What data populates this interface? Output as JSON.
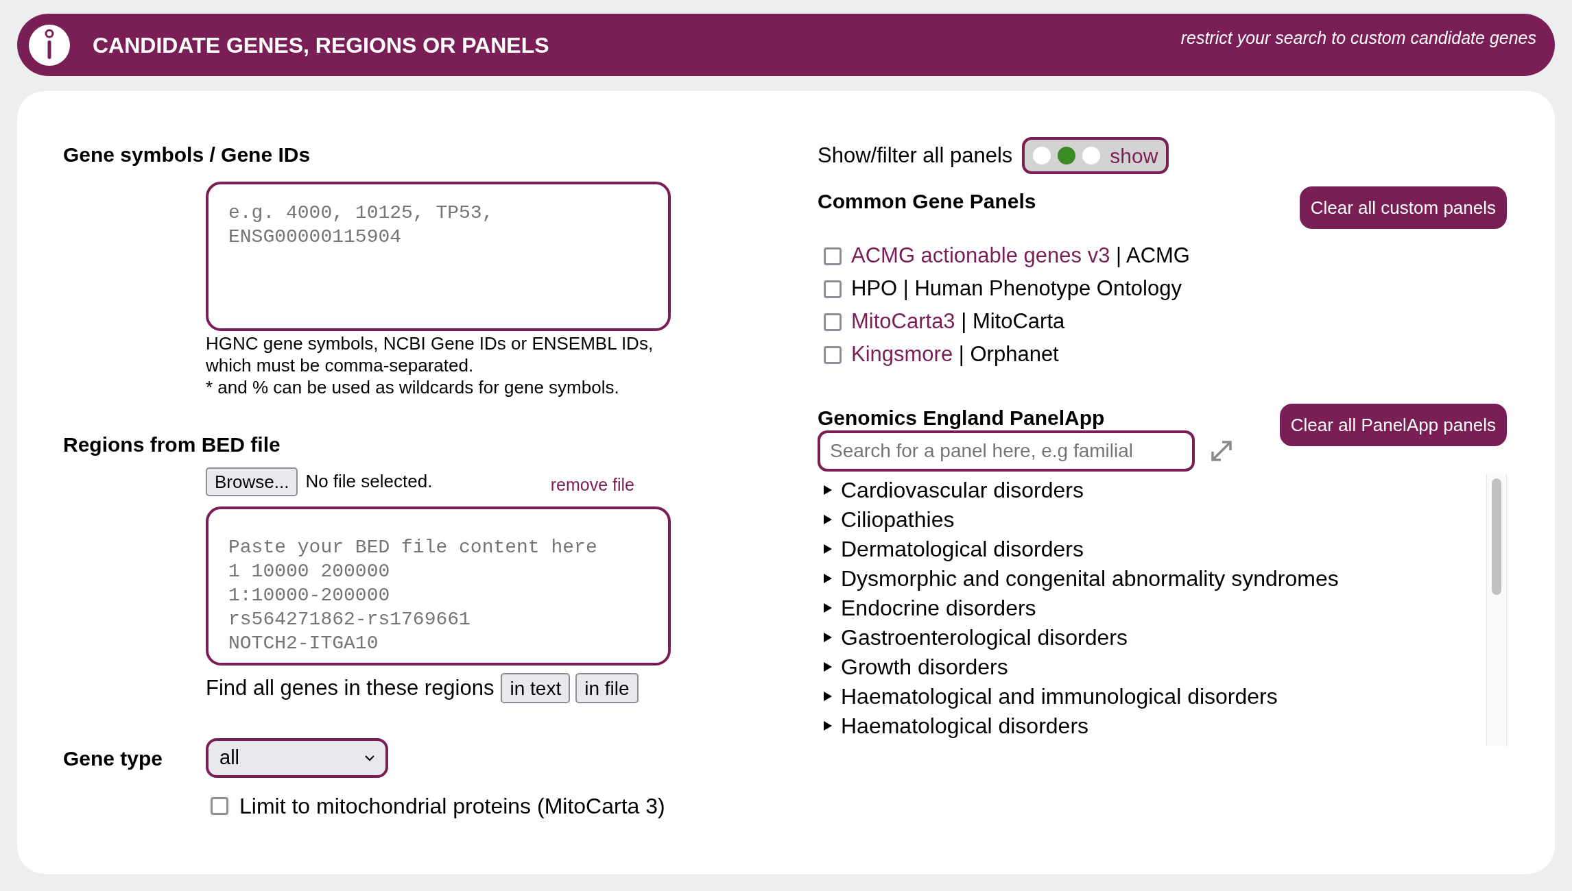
{
  "header": {
    "title": "CANDIDATE GENES, REGIONS OR PANELS",
    "subtitle": "restrict your search to custom candidate genes"
  },
  "gene_ids": {
    "label": "Gene symbols / Gene IDs",
    "placeholder": "e.g. 4000, 10125, TP53,\nENSG00000115904",
    "help": [
      "HGNC gene symbols, NCBI Gene IDs or ENSEMBL IDs,",
      "which must be comma-separated.",
      "* and % can be used as wildcards for gene symbols."
    ]
  },
  "bed": {
    "label": "Regions from BED file",
    "browse_button": "Browse...",
    "file_status": "No file selected.",
    "remove_link": "remove file",
    "placeholder": "Paste your BED file content here\n1 10000 200000\n1:10000-200000\nrs564271862-rs1769661\nNOTCH2-ITGA10",
    "find_label": "Find all genes in these regions",
    "find_buttons": [
      "in text",
      "in file"
    ]
  },
  "gene_type": {
    "label": "Gene type",
    "value": "all",
    "limit_label": "Limit to mitochondrial proteins (MitoCarta 3)",
    "limit_checked": false
  },
  "panels_filter": {
    "label": "Show/filter all panels",
    "toggle_label": "show",
    "positions": [
      {
        "selected": false
      },
      {
        "selected": true
      },
      {
        "selected": false
      }
    ]
  },
  "common_panels": {
    "title": "Common Gene Panels",
    "clear_button": "Clear all custom panels",
    "items": [
      {
        "name": "ACMG actionable genes v3",
        "link": true,
        "source": "| ACMG",
        "checked": false
      },
      {
        "name": "HPO",
        "link": false,
        "source": "| Human Phenotype Ontology",
        "checked": false
      },
      {
        "name": "MitoCarta3",
        "link": true,
        "source": "| MitoCarta",
        "checked": false
      },
      {
        "name": "Kingsmore",
        "link": true,
        "source": "| Orphanet",
        "checked": false
      }
    ]
  },
  "panelapp": {
    "title": "Genomics England PanelApp",
    "clear_button": "Clear all PanelApp panels",
    "search_placeholder": "Search for a panel here, e.g familial",
    "categories": [
      {
        "label": "Cardiovascular disorders",
        "expanded": false
      },
      {
        "label": "Ciliopathies",
        "expanded": false
      },
      {
        "label": "Dermatological disorders",
        "expanded": false
      },
      {
        "label": "Dysmorphic and congenital abnormality syndromes",
        "expanded": false
      },
      {
        "label": "Endocrine disorders",
        "expanded": false
      },
      {
        "label": "Gastroenterological disorders",
        "expanded": false
      },
      {
        "label": "Growth disorders",
        "expanded": false
      },
      {
        "label": "Haematological and immunological disorders",
        "expanded": false
      },
      {
        "label": "Haematological disorders",
        "expanded": false
      }
    ]
  }
}
